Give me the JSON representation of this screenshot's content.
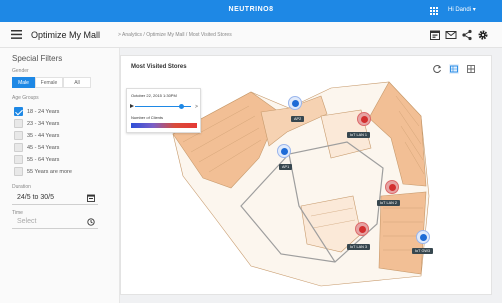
{
  "topbar": {
    "brand": "NEUTRINO8",
    "user": "Hi Dandi",
    "user_caret": "▾"
  },
  "appbar": {
    "title": "Optimize My Mall",
    "breadcrumb": "> Analytics / Optimize My Mall / Most Visited Stores"
  },
  "sidebar": {
    "title": "Special Filters",
    "gender_label": "Gender",
    "gender_options": [
      "Male",
      "Female",
      "All"
    ],
    "gender_selected": "Male",
    "age_label": "Age Groups",
    "age_groups": [
      {
        "label": "18 - 24 Years",
        "checked": true
      },
      {
        "label": "23 - 34 Years",
        "checked": false
      },
      {
        "label": "35 - 44 Years",
        "checked": false
      },
      {
        "label": "45 - 54 Years",
        "checked": false
      },
      {
        "label": "55 - 64 Years",
        "checked": false
      },
      {
        "label": "55 Years are more",
        "checked": false
      }
    ],
    "duration_label": "Duration",
    "duration_value": "24/5 to 30/5",
    "time_label": "Time",
    "time_placeholder": "Select"
  },
  "card": {
    "title": "Most Visited Stores",
    "legend": {
      "date": "October 22, 2015 1:30PM",
      "clients_label": "Number of Clients",
      "colors": [
        "#2d4fd8",
        "#e53935"
      ]
    },
    "markers": [
      {
        "label": "AP2",
        "type": "blue"
      },
      {
        "label": "IoT LAN 1",
        "type": "red"
      },
      {
        "label": "AP1",
        "type": "blue"
      },
      {
        "label": "IoT LAN 2",
        "type": "red"
      },
      {
        "label": "IoT LAN 3",
        "type": "red"
      },
      {
        "label": "IoT GW3",
        "type": "blue"
      }
    ]
  },
  "colors": {
    "accent": "#1e88e5",
    "floor": "#f2bf95",
    "hotspot": "#d32f2f"
  }
}
